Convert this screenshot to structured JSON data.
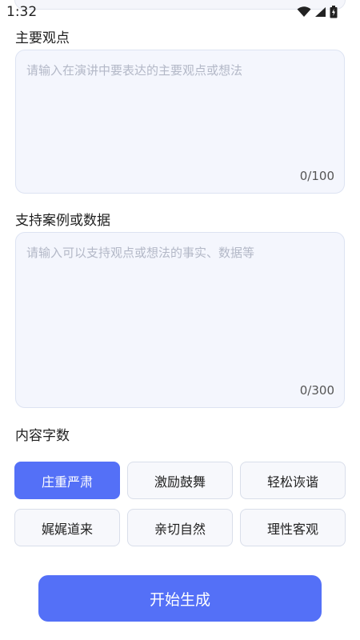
{
  "status_bar": {
    "time": "1:32",
    "icons": [
      "wifi-icon",
      "signal-icon",
      "battery-icon"
    ]
  },
  "main_point": {
    "label": "主要观点",
    "placeholder": "请输入在演讲中要表达的主要观点或想法",
    "counter": "0/100"
  },
  "support": {
    "label": "支持案例或数据",
    "placeholder": "请输入可以支持观点或想法的事实、数据等",
    "counter": "0/300"
  },
  "tone": {
    "label": "内容字数",
    "options": [
      "庄重严肃",
      "激励鼓舞",
      "轻松诙谐",
      "娓娓道来",
      "亲切自然",
      "理性客观"
    ],
    "selected": "庄重严肃"
  },
  "generate_label": "开始生成",
  "colors": {
    "accent": "#5470f7",
    "field_bg": "#f4f6fd",
    "placeholder": "#b3b8c7"
  }
}
